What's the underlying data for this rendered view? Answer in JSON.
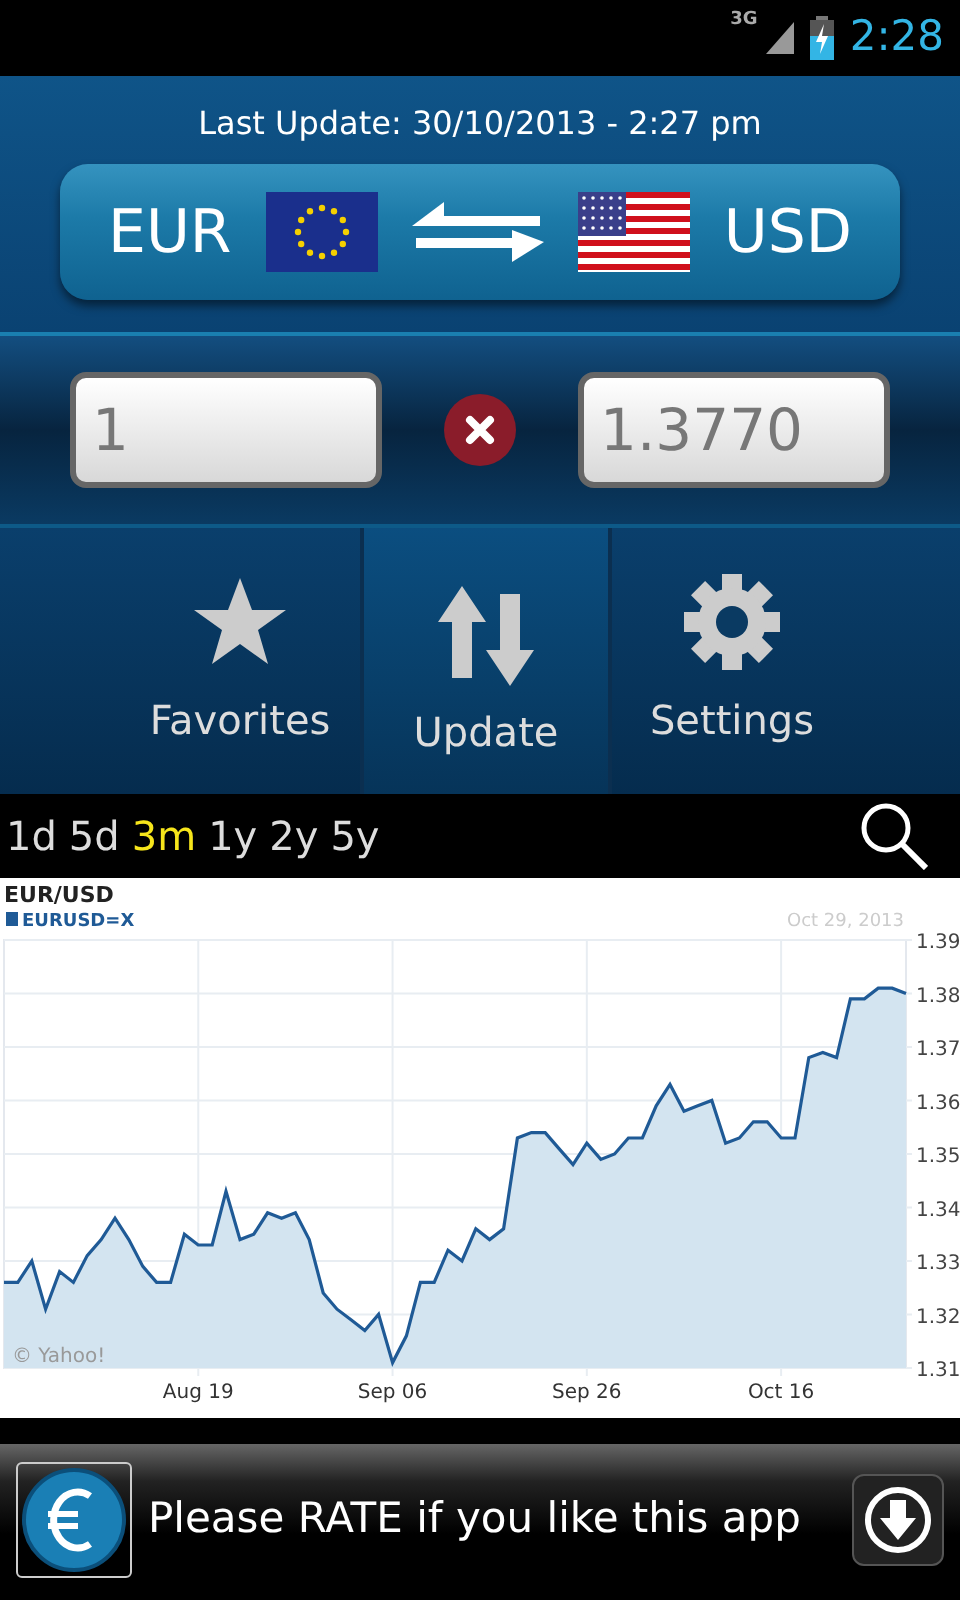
{
  "status_bar": {
    "network": "3G",
    "time": "2:28"
  },
  "header": {
    "last_update": "Last Update: 30/10/2013 - 2:27 pm",
    "from_currency": "EUR",
    "to_currency": "USD"
  },
  "converter": {
    "amount": "1",
    "result": "1.3770"
  },
  "actions": [
    {
      "kind": "favorites",
      "label": "Favorites"
    },
    {
      "kind": "update",
      "label": "Update"
    },
    {
      "kind": "settings",
      "label": "Settings"
    }
  ],
  "ranges": [
    {
      "label": "1d",
      "selected": false
    },
    {
      "label": "5d",
      "selected": false
    },
    {
      "label": "3m",
      "selected": true
    },
    {
      "label": "1y",
      "selected": false
    },
    {
      "label": "2y",
      "selected": false
    },
    {
      "label": "5y",
      "selected": false
    }
  ],
  "chart": {
    "date": "Oct 29, 2013",
    "credit": "© Yahoo!",
    "chart_data": {
      "type": "area",
      "title": "EUR/USD",
      "grid": true,
      "categories": [
        null,
        null,
        null,
        null,
        null,
        null,
        null,
        null,
        null,
        null,
        null,
        null,
        null,
        null,
        "Aug 19",
        null,
        null,
        null,
        null,
        null,
        null,
        null,
        null,
        null,
        null,
        null,
        null,
        null,
        "Sep 06",
        null,
        null,
        null,
        null,
        null,
        null,
        null,
        null,
        null,
        null,
        null,
        null,
        null,
        "Sep 26",
        null,
        null,
        null,
        null,
        null,
        null,
        null,
        null,
        null,
        null,
        null,
        null,
        null,
        "Oct 16",
        null,
        null,
        null,
        null,
        null,
        null,
        null,
        null,
        null
      ],
      "series": [
        {
          "name": "EURUSD=X",
          "color": "#1f5a96",
          "values": [
            1.326,
            1.326,
            1.33,
            1.321,
            1.328,
            1.326,
            1.331,
            1.334,
            1.338,
            1.334,
            1.329,
            1.326,
            1.326,
            1.335,
            1.333,
            1.333,
            1.343,
            1.334,
            1.335,
            1.339,
            1.338,
            1.339,
            1.334,
            1.324,
            1.321,
            1.319,
            1.317,
            1.32,
            1.311,
            1.316,
            1.326,
            1.326,
            1.332,
            1.33,
            1.336,
            1.334,
            1.336,
            1.353,
            1.354,
            1.354,
            1.351,
            1.348,
            1.352,
            1.349,
            1.35,
            1.353,
            1.353,
            1.359,
            1.363,
            1.358,
            1.359,
            1.36,
            1.352,
            1.353,
            1.356,
            1.356,
            1.353,
            1.353,
            1.368,
            1.369,
            1.368,
            1.379,
            1.379,
            1.381,
            1.381,
            1.38
          ]
        }
      ],
      "ylim": [
        1.31,
        1.39
      ],
      "yticks": [
        1.31,
        1.32,
        1.33,
        1.34,
        1.35,
        1.36,
        1.37,
        1.38,
        1.39
      ]
    }
  },
  "ad": {
    "text": "Please RATE if you like this app"
  }
}
